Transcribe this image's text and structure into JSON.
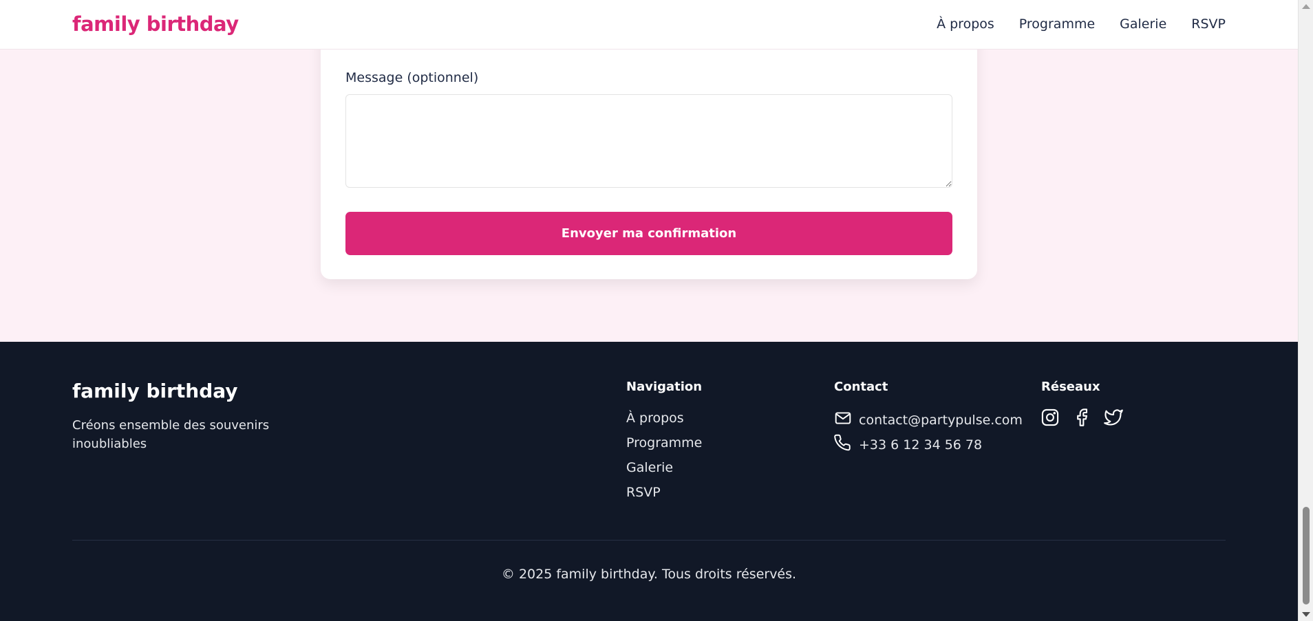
{
  "header": {
    "brand": "family birthday",
    "nav": [
      "À propos",
      "Programme",
      "Galerie",
      "RSVP"
    ]
  },
  "form": {
    "message_label": "Message (optionnel)",
    "message_value": "",
    "submit_label": "Envoyer ma confirmation"
  },
  "footer": {
    "brand": "family birthday",
    "tagline": "Créons ensemble des souvenirs inoubliables",
    "navigation_title": "Navigation",
    "navigation_links": [
      "À propos",
      "Programme",
      "Galerie",
      "RSVP"
    ],
    "contact_title": "Contact",
    "email": "contact@partypulse.com",
    "phone": "+33 6 12 34 56 78",
    "social_title": "Réseaux",
    "social_icons": [
      "instagram-icon",
      "facebook-icon",
      "twitter-icon"
    ],
    "copyright": "© 2025 family birthday. Tous droits réservés."
  },
  "colors": {
    "accent": "#db2777",
    "page_background": "#fdf0f6",
    "footer_background": "#111827"
  }
}
